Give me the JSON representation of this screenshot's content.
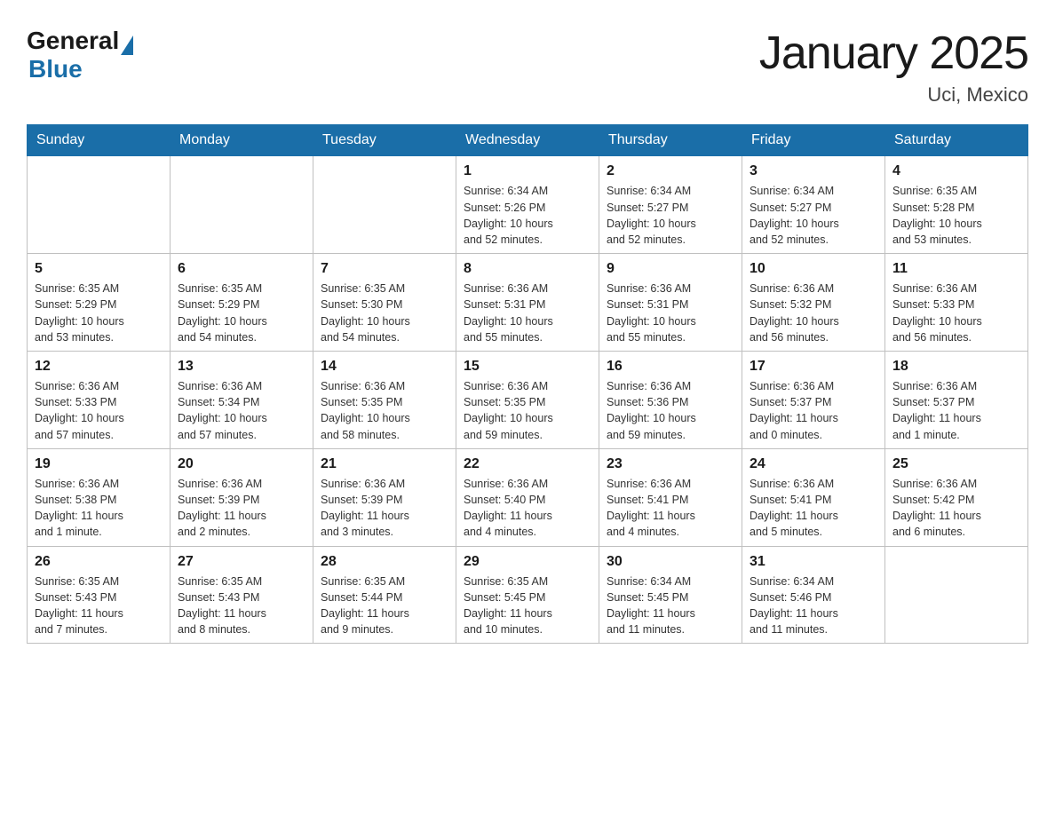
{
  "header": {
    "logo_general": "General",
    "logo_blue": "Blue",
    "month_title": "January 2025",
    "location": "Uci, Mexico"
  },
  "days_of_week": [
    "Sunday",
    "Monday",
    "Tuesday",
    "Wednesday",
    "Thursday",
    "Friday",
    "Saturday"
  ],
  "weeks": [
    [
      {
        "day": "",
        "info": ""
      },
      {
        "day": "",
        "info": ""
      },
      {
        "day": "",
        "info": ""
      },
      {
        "day": "1",
        "info": "Sunrise: 6:34 AM\nSunset: 5:26 PM\nDaylight: 10 hours\nand 52 minutes."
      },
      {
        "day": "2",
        "info": "Sunrise: 6:34 AM\nSunset: 5:27 PM\nDaylight: 10 hours\nand 52 minutes."
      },
      {
        "day": "3",
        "info": "Sunrise: 6:34 AM\nSunset: 5:27 PM\nDaylight: 10 hours\nand 52 minutes."
      },
      {
        "day": "4",
        "info": "Sunrise: 6:35 AM\nSunset: 5:28 PM\nDaylight: 10 hours\nand 53 minutes."
      }
    ],
    [
      {
        "day": "5",
        "info": "Sunrise: 6:35 AM\nSunset: 5:29 PM\nDaylight: 10 hours\nand 53 minutes."
      },
      {
        "day": "6",
        "info": "Sunrise: 6:35 AM\nSunset: 5:29 PM\nDaylight: 10 hours\nand 54 minutes."
      },
      {
        "day": "7",
        "info": "Sunrise: 6:35 AM\nSunset: 5:30 PM\nDaylight: 10 hours\nand 54 minutes."
      },
      {
        "day": "8",
        "info": "Sunrise: 6:36 AM\nSunset: 5:31 PM\nDaylight: 10 hours\nand 55 minutes."
      },
      {
        "day": "9",
        "info": "Sunrise: 6:36 AM\nSunset: 5:31 PM\nDaylight: 10 hours\nand 55 minutes."
      },
      {
        "day": "10",
        "info": "Sunrise: 6:36 AM\nSunset: 5:32 PM\nDaylight: 10 hours\nand 56 minutes."
      },
      {
        "day": "11",
        "info": "Sunrise: 6:36 AM\nSunset: 5:33 PM\nDaylight: 10 hours\nand 56 minutes."
      }
    ],
    [
      {
        "day": "12",
        "info": "Sunrise: 6:36 AM\nSunset: 5:33 PM\nDaylight: 10 hours\nand 57 minutes."
      },
      {
        "day": "13",
        "info": "Sunrise: 6:36 AM\nSunset: 5:34 PM\nDaylight: 10 hours\nand 57 minutes."
      },
      {
        "day": "14",
        "info": "Sunrise: 6:36 AM\nSunset: 5:35 PM\nDaylight: 10 hours\nand 58 minutes."
      },
      {
        "day": "15",
        "info": "Sunrise: 6:36 AM\nSunset: 5:35 PM\nDaylight: 10 hours\nand 59 minutes."
      },
      {
        "day": "16",
        "info": "Sunrise: 6:36 AM\nSunset: 5:36 PM\nDaylight: 10 hours\nand 59 minutes."
      },
      {
        "day": "17",
        "info": "Sunrise: 6:36 AM\nSunset: 5:37 PM\nDaylight: 11 hours\nand 0 minutes."
      },
      {
        "day": "18",
        "info": "Sunrise: 6:36 AM\nSunset: 5:37 PM\nDaylight: 11 hours\nand 1 minute."
      }
    ],
    [
      {
        "day": "19",
        "info": "Sunrise: 6:36 AM\nSunset: 5:38 PM\nDaylight: 11 hours\nand 1 minute."
      },
      {
        "day": "20",
        "info": "Sunrise: 6:36 AM\nSunset: 5:39 PM\nDaylight: 11 hours\nand 2 minutes."
      },
      {
        "day": "21",
        "info": "Sunrise: 6:36 AM\nSunset: 5:39 PM\nDaylight: 11 hours\nand 3 minutes."
      },
      {
        "day": "22",
        "info": "Sunrise: 6:36 AM\nSunset: 5:40 PM\nDaylight: 11 hours\nand 4 minutes."
      },
      {
        "day": "23",
        "info": "Sunrise: 6:36 AM\nSunset: 5:41 PM\nDaylight: 11 hours\nand 4 minutes."
      },
      {
        "day": "24",
        "info": "Sunrise: 6:36 AM\nSunset: 5:41 PM\nDaylight: 11 hours\nand 5 minutes."
      },
      {
        "day": "25",
        "info": "Sunrise: 6:36 AM\nSunset: 5:42 PM\nDaylight: 11 hours\nand 6 minutes."
      }
    ],
    [
      {
        "day": "26",
        "info": "Sunrise: 6:35 AM\nSunset: 5:43 PM\nDaylight: 11 hours\nand 7 minutes."
      },
      {
        "day": "27",
        "info": "Sunrise: 6:35 AM\nSunset: 5:43 PM\nDaylight: 11 hours\nand 8 minutes."
      },
      {
        "day": "28",
        "info": "Sunrise: 6:35 AM\nSunset: 5:44 PM\nDaylight: 11 hours\nand 9 minutes."
      },
      {
        "day": "29",
        "info": "Sunrise: 6:35 AM\nSunset: 5:45 PM\nDaylight: 11 hours\nand 10 minutes."
      },
      {
        "day": "30",
        "info": "Sunrise: 6:34 AM\nSunset: 5:45 PM\nDaylight: 11 hours\nand 11 minutes."
      },
      {
        "day": "31",
        "info": "Sunrise: 6:34 AM\nSunset: 5:46 PM\nDaylight: 11 hours\nand 11 minutes."
      },
      {
        "day": "",
        "info": ""
      }
    ]
  ]
}
